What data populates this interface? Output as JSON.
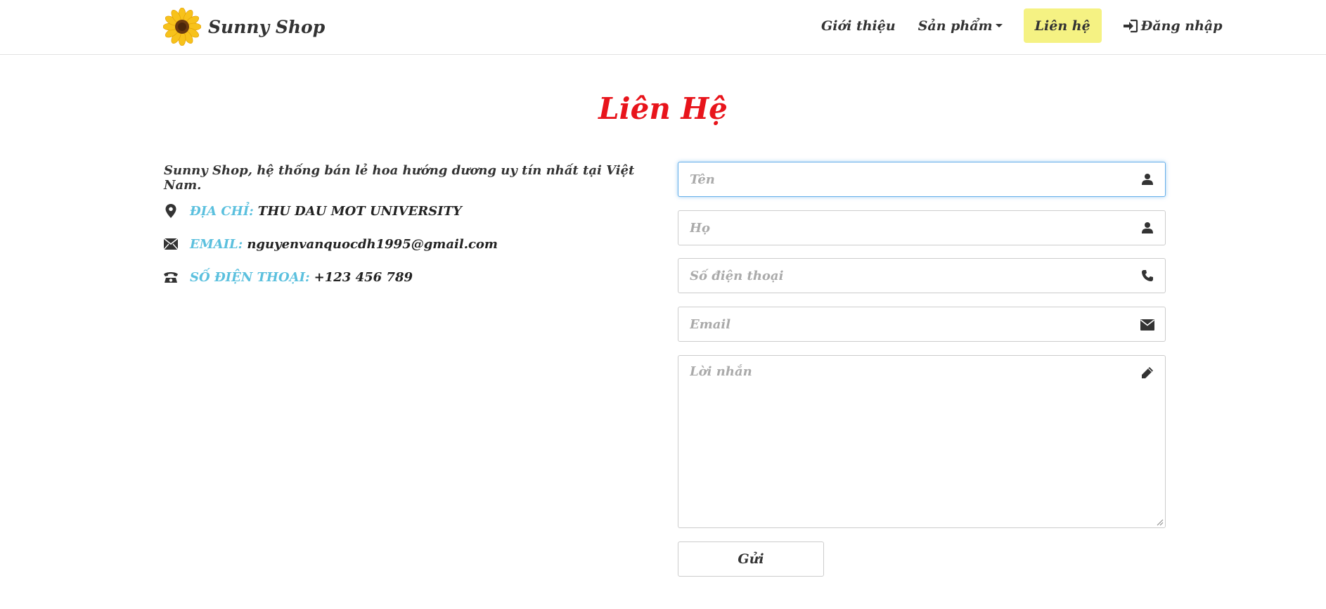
{
  "brand": {
    "name": "Sunny Shop",
    "logo_icon": "sunflower-icon"
  },
  "nav": {
    "items": [
      {
        "label": "Giới thiệu",
        "active": false
      },
      {
        "label": "Sản phẩm",
        "active": false,
        "has_dropdown": true
      },
      {
        "label": "Liên hệ",
        "active": true
      },
      {
        "label": "Đăng nhập",
        "active": false,
        "icon": "login-icon"
      }
    ],
    "active_color": "#f5f283"
  },
  "page": {
    "title": "Liên Hệ",
    "title_color": "#e8141b"
  },
  "contact_info": {
    "intro": "Sunny Shop, hệ thống bán lẻ hoa hướng dương uy tín nhất tại Việt Nam.",
    "label_color": "#5bc0de",
    "rows": [
      {
        "icon": "map-marker-icon",
        "label": "ĐỊA CHỈ:",
        "value": "THU DAU MOT UNIVERSITY"
      },
      {
        "icon": "envelope-icon",
        "label": "EMAIL:",
        "value": "nguyenvanquocdh1995@gmail.com"
      },
      {
        "icon": "phone-alt-icon",
        "label": "SỐ ĐIỆN THOẠI:",
        "value": "+123 456 789"
      }
    ]
  },
  "form": {
    "first_name": {
      "placeholder": "Tên",
      "value": "",
      "icon": "user-icon",
      "focused": true
    },
    "last_name": {
      "placeholder": "Họ",
      "value": "",
      "icon": "user-icon"
    },
    "phone": {
      "placeholder": "Số điện thoại",
      "value": "",
      "icon": "phone-icon"
    },
    "email": {
      "placeholder": "Email",
      "value": "",
      "icon": "envelope-icon"
    },
    "message": {
      "placeholder": "Lời nhắn",
      "value": "",
      "icon": "pencil-icon"
    },
    "submit_label": "Gửi"
  }
}
